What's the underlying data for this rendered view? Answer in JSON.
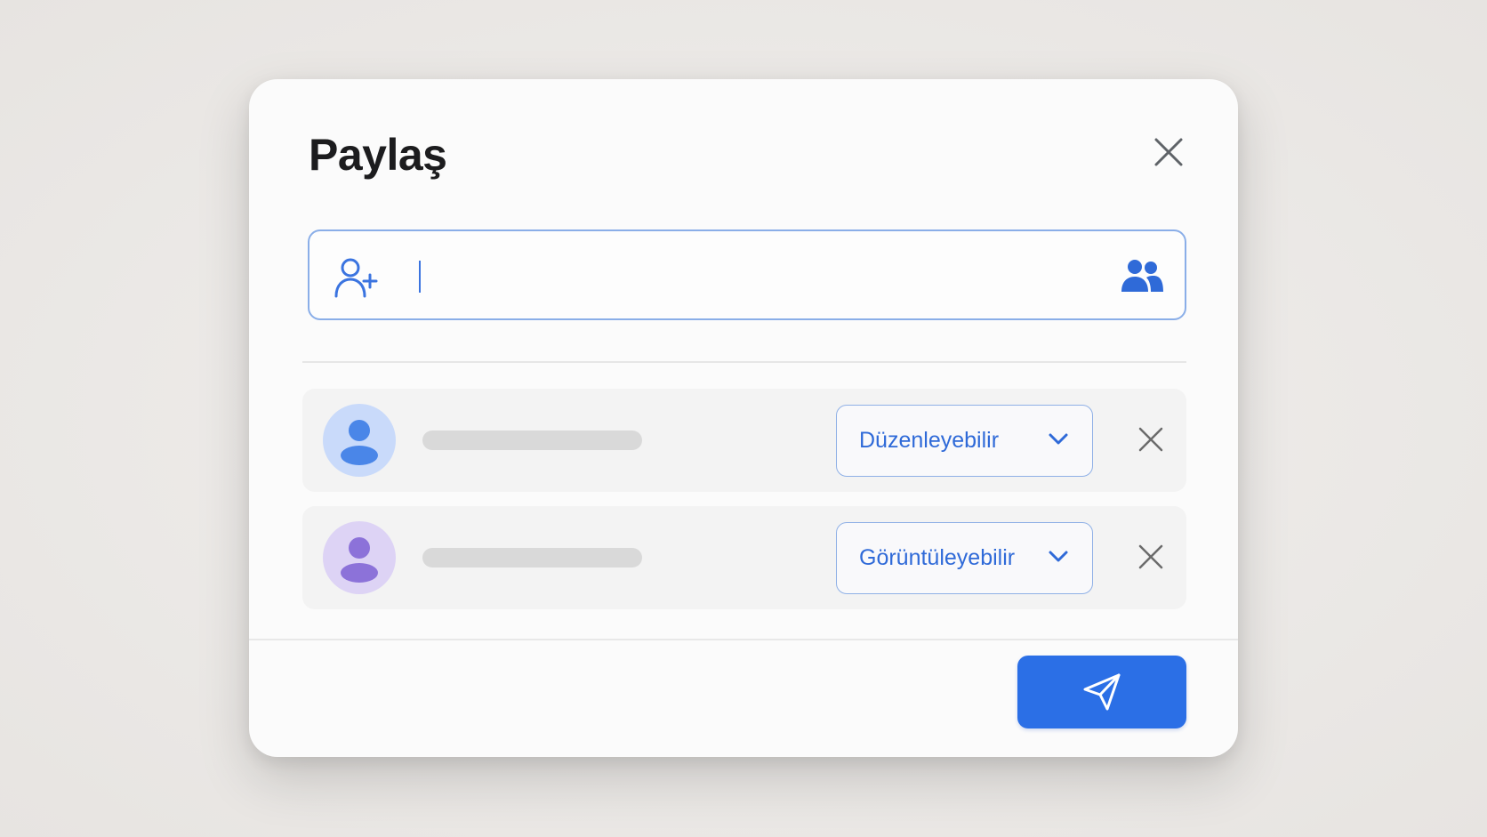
{
  "dialog": {
    "title": "Paylaş",
    "close_icon": "close-icon"
  },
  "search": {
    "placeholder": "",
    "value": "",
    "leading_icon": "person-add-icon",
    "trailing_icon": "groups-icon"
  },
  "people": [
    {
      "avatar_icon": "person-icon",
      "avatar_bg": "#c9dafa",
      "avatar_fg": "#4a86e8",
      "role": "Düzenleyebilir",
      "remove_icon": "close-icon"
    },
    {
      "avatar_icon": "person-icon",
      "avatar_bg": "#ddd3f5",
      "avatar_fg": "#8c72d9",
      "role": "Görüntüleyebilir",
      "remove_icon": "close-icon"
    }
  ],
  "footer": {
    "send_icon": "send-icon"
  },
  "colors": {
    "accent": "#2b6fe6",
    "accent_text": "#2f6ad8",
    "input_border": "#8aaee8"
  }
}
